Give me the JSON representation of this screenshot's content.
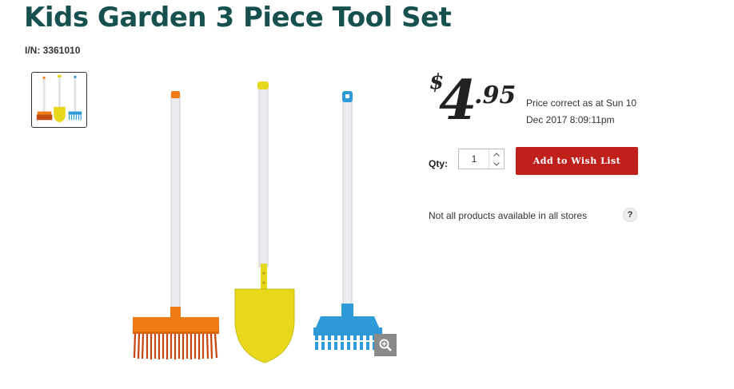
{
  "product": {
    "title": "Kids Garden 3 Piece Tool Set",
    "item_number": "I/N: 3361010"
  },
  "price": {
    "currency": "$",
    "whole": "4",
    "cents": ".95",
    "note": "Price correct as at Sun 10 Dec 2017 8:09:11pm"
  },
  "purchase": {
    "qty_label": "Qty:",
    "qty_value": "1",
    "wish_button": "Add to Wish List"
  },
  "availability": {
    "text": "Not all products available in all stores",
    "help_glyph": "?"
  },
  "images": {
    "tools": [
      "broom",
      "shovel",
      "rake"
    ],
    "colors": {
      "broom": "#f07a14",
      "shovel": "#e8d81c",
      "rake": "#2e9ad8",
      "handle": "#e9ebee"
    },
    "zoom_icon": "zoom-in-icon"
  },
  "theme": {
    "title_color": "#16504f",
    "button_color": "#c0201c"
  }
}
